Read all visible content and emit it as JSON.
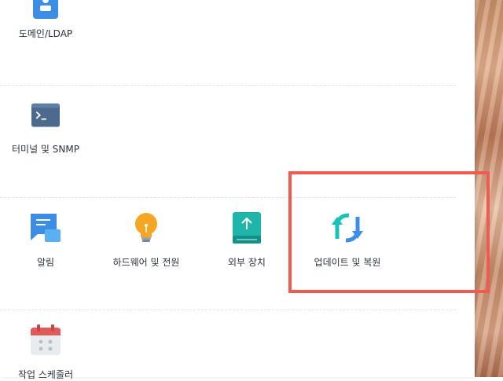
{
  "sections": [
    {
      "items": [
        {
          "label": "도메인/LDAP",
          "icon": "domain-ldap-icon"
        }
      ]
    },
    {
      "items": [
        {
          "label": "터미널 및 SNMP",
          "icon": "terminal-icon"
        }
      ]
    },
    {
      "items": [
        {
          "label": "알림",
          "icon": "notification-icon"
        },
        {
          "label": "하드웨어 및 전원",
          "icon": "hardware-power-icon"
        },
        {
          "label": "외부 장치",
          "icon": "external-devices-icon"
        },
        {
          "label": "업데이트 및 복원",
          "icon": "update-restore-icon"
        }
      ]
    },
    {
      "items": [
        {
          "label": "작업 스케줄러",
          "icon": "task-scheduler-icon"
        }
      ]
    }
  ],
  "colors": {
    "highlight": "#ef5b50",
    "terminal": "#4c6a8e",
    "notification": "#3b8de6",
    "bulb": "#f5a623",
    "external": "#1fb5ab",
    "update_teal": "#17c2b8",
    "update_blue": "#3e8ee8",
    "calendar_red": "#e05a5a"
  }
}
